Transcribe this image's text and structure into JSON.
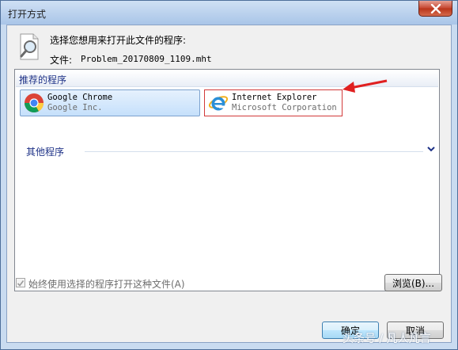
{
  "window": {
    "title": "打开方式"
  },
  "header": {
    "prompt": "选择您想用来打开此文件的程序:",
    "file_label": "文件:",
    "file_name": "Problem_20170809_1109.mht"
  },
  "recommended": {
    "label": "推荐的程序",
    "items": [
      {
        "name": "Google Chrome",
        "company": "Google Inc.",
        "icon": "chrome-icon",
        "selected": true
      },
      {
        "name": "Internet Explorer",
        "company": "Microsoft Corporation",
        "icon": "ie-icon",
        "highlighted": true
      }
    ]
  },
  "other": {
    "label": "其他程序"
  },
  "footer": {
    "always_use_label": "始终使用选择的程序打开这种文件(A)",
    "browse_label": "浏览(B)...",
    "ok_label": "确定",
    "cancel_label": "取消"
  },
  "watermark": "头条号 / 凡人凡言",
  "colors": {
    "highlight_border": "#d23a3a",
    "selection_bg": "#c6e0fb",
    "section_label": "#1e3287"
  }
}
